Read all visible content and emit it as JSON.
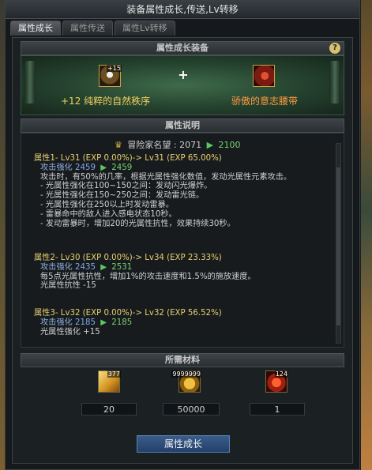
{
  "window": {
    "title": "装备属性成长,传送,Lv转移"
  },
  "tabs": [
    {
      "label": "属性成长"
    },
    {
      "label": "属性传送"
    },
    {
      "label": "属性Lv转移"
    }
  ],
  "equip_section": {
    "title": "属性成长装备",
    "help": "?",
    "plus": "+",
    "item1": {
      "badge": "+15",
      "name": "+12  纯粹的自然秩序"
    },
    "item2": {
      "name": "骄傲的意志腰带"
    }
  },
  "desc_section": {
    "title": "属性说明",
    "fame": {
      "label": "冒险家名望 : 2071",
      "to": "2100"
    },
    "attr1": {
      "title": "属性1- Lv31 (EXP 0.00%)-> Lv31 (EXP 65.00%)",
      "stat_label": "攻击强化",
      "stat_from": "2459",
      "stat_to": "2459",
      "lines": [
        "攻击时，有50%的几率，根据光属性强化数值，发动光属性元素攻击。",
        "- 光属性强化在100~150之间：发动闪光爆炸。",
        "- 光属性强化在150~250之间：发动雷光链。",
        "- 光属性强化在250以上时发动雷暴。",
        "- 雷暴命中的敌人进入感电状态10秒。",
        "- 发动雷暴时，增加20的光属性抗性，效果持续30秒。"
      ]
    },
    "attr2": {
      "title": "属性2- Lv30 (EXP 0.00%)-> Lv34 (EXP 23.33%)",
      "stat_label": "攻击强化",
      "stat_from": "2435",
      "stat_to": "2531",
      "lines": [
        "每5点光属性抗性，增加1%的攻击速度和1.5%的施放速度。",
        "光属性抗性 -15"
      ]
    },
    "attr3": {
      "title": "属性3- Lv32 (EXP 0.00%)-> Lv32 (EXP 56.52%)",
      "stat_label": "攻击强化",
      "stat_from": "2185",
      "stat_to": "2185",
      "lines": [
        "光属性强化 +15"
      ]
    }
  },
  "materials": {
    "title": "所需材料",
    "items": [
      {
        "badge": "377",
        "count": "20"
      },
      {
        "badge": "9999999",
        "count": "50000"
      },
      {
        "badge": "124",
        "count": "1"
      }
    ]
  },
  "action": {
    "label": "属性成长"
  }
}
